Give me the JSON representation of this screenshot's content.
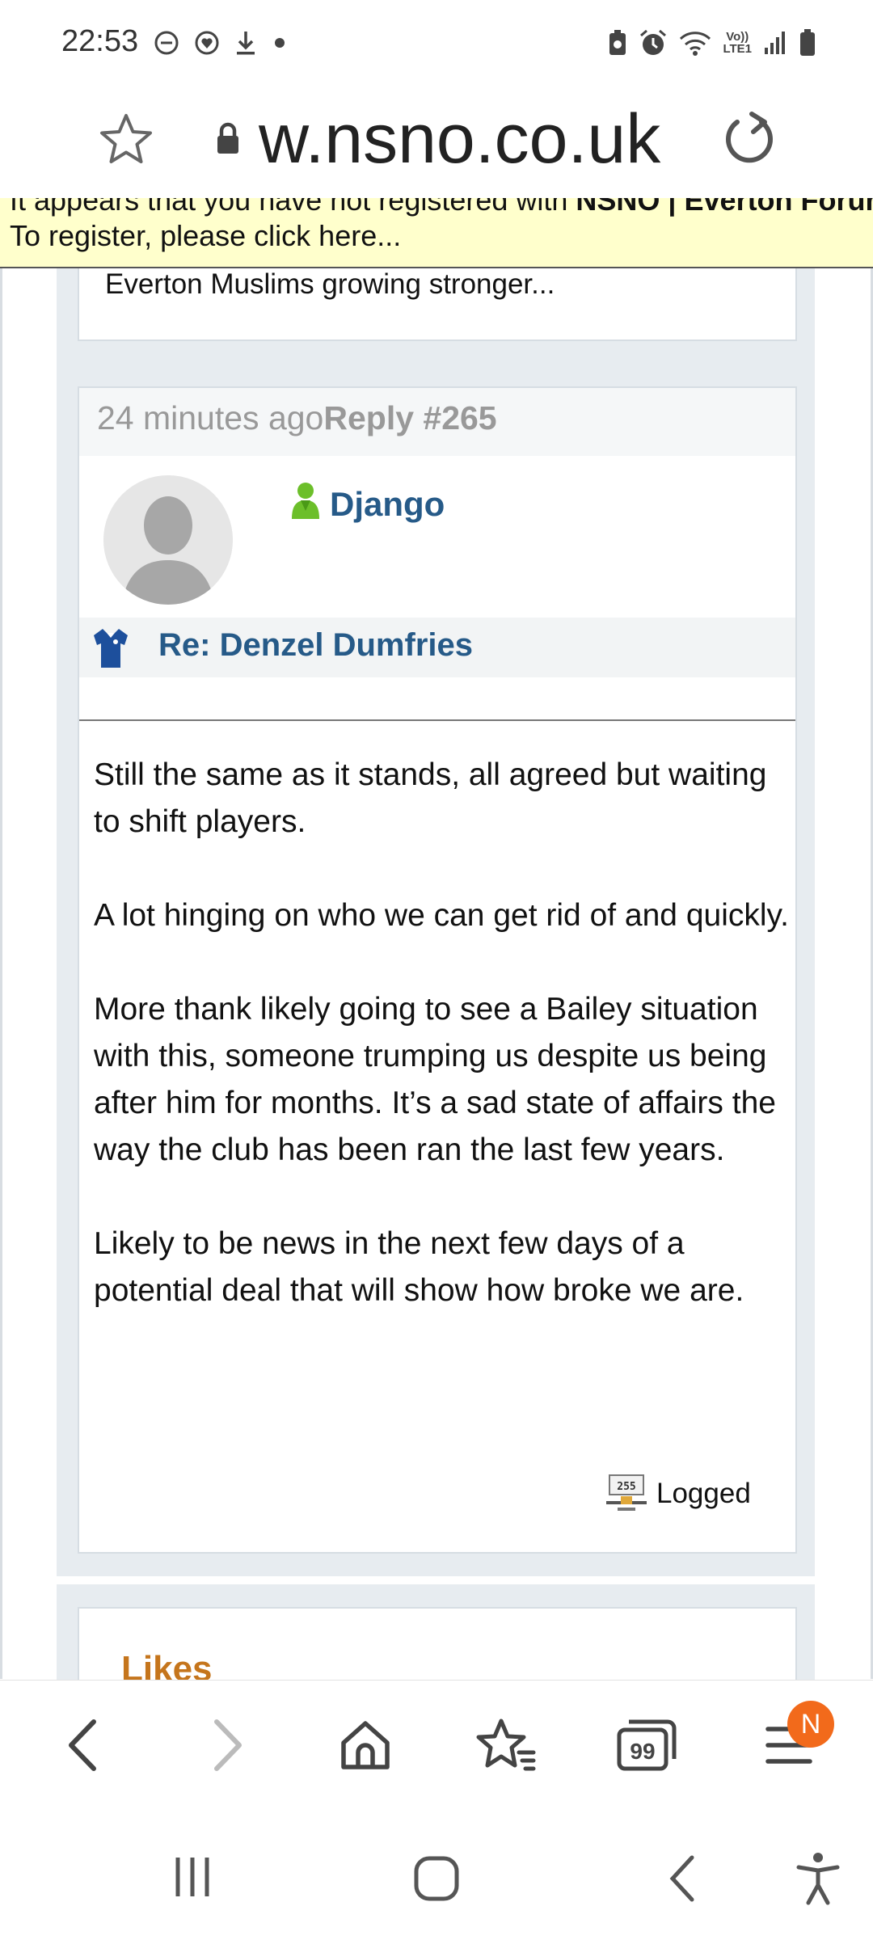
{
  "status_bar": {
    "time": "22:53",
    "left_icons": [
      "do-not-disturb-icon",
      "heart-notification-icon",
      "download-icon",
      "dot-icon"
    ],
    "right_icons": [
      "battery-saver-icon",
      "alarm-icon",
      "wifi-icon",
      "volte-icon",
      "signal-icon",
      "battery-icon"
    ],
    "volte_label": "Vo))",
    "lte_label": "LTE1"
  },
  "browser": {
    "url": "w.nsno.co.uk",
    "star_icon": "star-outline-icon",
    "reload_icon": "reload-icon",
    "lock_icon": "lock-icon"
  },
  "register_banner": {
    "line1_prefix": "It appears that you have not registered with ",
    "line1_site": "NSNO | Everton Forum",
    "line2": "To register, please click here..."
  },
  "previous_post": {
    "text": "Everton Muslims growing stronger..."
  },
  "post": {
    "time": "24 minutes ago",
    "reply": "Reply #265",
    "username": "Django",
    "subject": "Re: Denzel Dumfries",
    "paragraphs": [
      "Still the same as it stands, all agreed but waiting to shift players.",
      "A lot hinging on who we can get rid of and quickly.",
      "More thank likely going to see a Bailey situation with this, someone trumping us despite us being after him for months. It’s a sad state of affairs the way the club has been ran the last few years.",
      "Likely to be news in the next few days of a potential deal that will show how broke we are."
    ],
    "logged_label": "Logged",
    "logged_icon_text": "255"
  },
  "likes": {
    "title": "Likes"
  },
  "bottom_nav": {
    "badge": "N",
    "tabs_count": "99"
  },
  "colors": {
    "link": "#265a88",
    "banner": "#ffffcc",
    "likes": "#c5751c",
    "badge": "#f26a1b"
  }
}
